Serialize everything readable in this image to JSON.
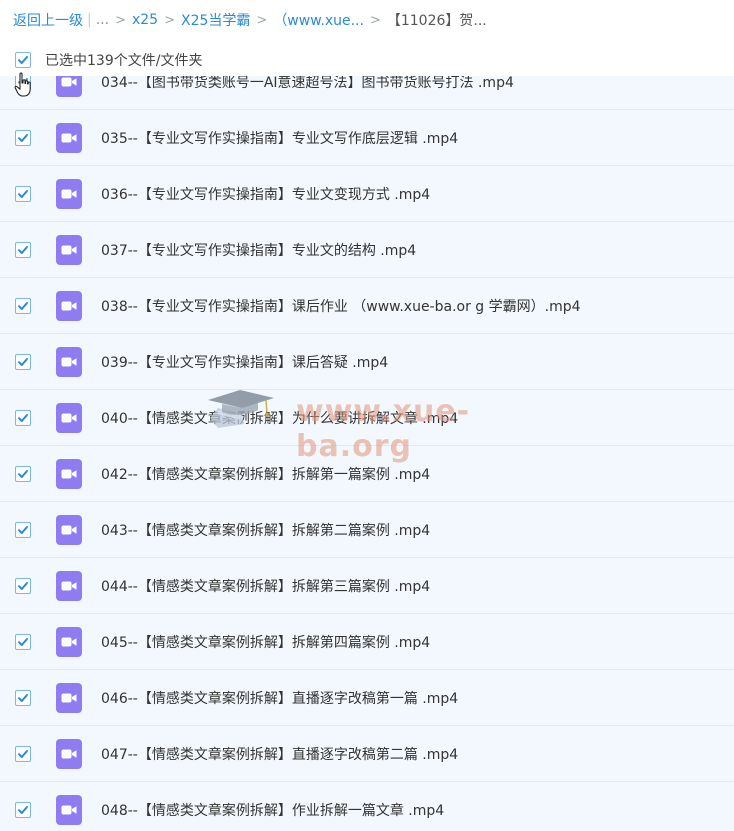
{
  "breadcrumb": {
    "back": "返回上一级",
    "ellipsis": "...",
    "items": [
      "x25",
      "X25当学霸",
      "（www.xue...",
      "【11026】贺..."
    ]
  },
  "selection": {
    "label": "已选中139个文件/文件夹"
  },
  "files": [
    "034--【图书带货类账号一AI意速超号法】图书带货账号打法 .mp4",
    "035--【专业文写作实操指南】专业文写作底层逻辑 .mp4",
    "036--【专业文写作实操指南】专业文变现方式 .mp4",
    "037--【专业文写作实操指南】专业文的结构 .mp4",
    "038--【专业文写作实操指南】课后作业 （www.xue-ba.or g 学霸网）.mp4",
    "039--【专业文写作实操指南】课后答疑 .mp4",
    "040--【情感类文章案例拆解】为什么要讲拆解文章 .mp4",
    "042--【情感类文章案例拆解】拆解第一篇案例 .mp4",
    "043--【情感类文章案例拆解】拆解第二篇案例 .mp4",
    "044--【情感类文章案例拆解】拆解第三篇案例 .mp4",
    "045--【情感类文章案例拆解】拆解第四篇案例 .mp4",
    "046--【情感类文章案例拆解】直播逐字改稿第一篇 .mp4",
    "047--【情感类文章案例拆解】直播逐字改稿第二篇 .mp4",
    "048--【情感类文章案例拆解】作业拆解一篇文章 .mp4"
  ],
  "watermark": {
    "text": "www.xue-ba.org"
  },
  "colors": {
    "link": "#2b8ad8",
    "checkbox": "#2b8ad8",
    "row_bg": "#f2f8fe",
    "video_icon": "#8e7cf0"
  },
  "icons": {
    "checkbox": "check-icon",
    "file": "video-file-icon",
    "cursor": "hand-pointer-icon"
  }
}
